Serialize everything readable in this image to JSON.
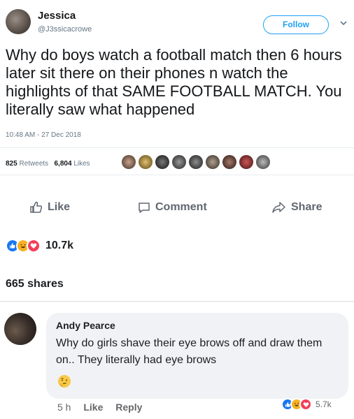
{
  "tweet": {
    "display_name": "Jessica",
    "handle": "@J3ssicacrowe",
    "follow_label": "Follow",
    "text": "Why do boys watch a football match then 6 hours later sit there on their phones n watch the highlights of that SAME FOOTBALL MATCH. You literally saw what happened",
    "timestamp": "10:48 AM - 27 Dec 2018",
    "retweets_count": "825",
    "retweets_label": "Retweets",
    "likes_count": "6,804",
    "likes_label": "Likes",
    "icons": {
      "dropdown": "chevron-down-icon"
    },
    "accent_color": "#1da1f2"
  },
  "post": {
    "actions": [
      {
        "label": "Like",
        "icon": "thumbs-up-icon"
      },
      {
        "label": "Comment",
        "icon": "comment-icon"
      },
      {
        "label": "Share",
        "icon": "share-icon"
      }
    ],
    "reaction_count": "10.7k",
    "reaction_icons": [
      "like-reaction-icon",
      "haha-reaction-icon",
      "love-reaction-icon"
    ],
    "shares": "665 shares"
  },
  "comment": {
    "author": "Andy Pearce",
    "text": "Why do girls shave their eye brows off and draw them on.. They literally had eye brows",
    "emoji": "thinking-face-icon",
    "time": "5 h",
    "like_label": "Like",
    "reply_label": "Reply",
    "reaction_count": "5.7k"
  },
  "colors": {
    "like_blue": "#1877f2",
    "love_red": "#f33e58",
    "haha_yellow": "#f7b125"
  }
}
